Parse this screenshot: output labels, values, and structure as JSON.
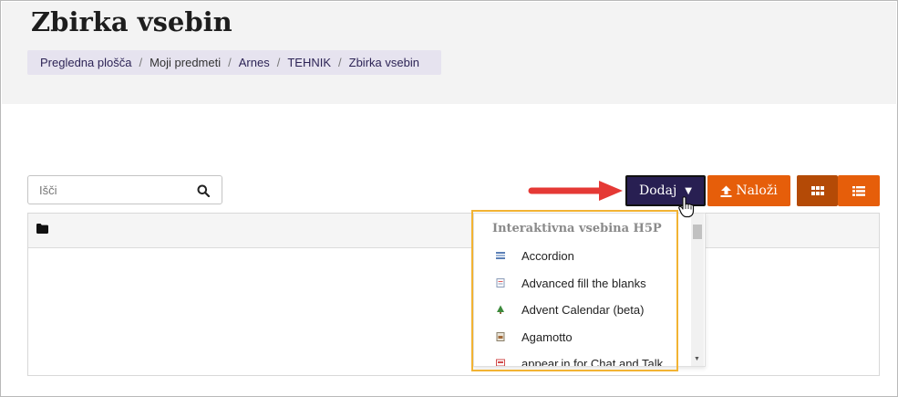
{
  "page": {
    "title": "Zbirka vsebin"
  },
  "breadcrumb": {
    "items": [
      "Pregledna plošča",
      "Moji predmeti",
      "Arnes",
      "TEHNIK",
      "Zbirka vsebin"
    ]
  },
  "search": {
    "placeholder": "Išči",
    "value": ""
  },
  "toolbar": {
    "add_label": "Dodaj",
    "upload_label": "Naloži"
  },
  "dropdown": {
    "header": "Interaktivna vsebina H5P",
    "items": [
      {
        "label": "Accordion",
        "icon": "accordion-icon"
      },
      {
        "label": "Advanced fill the blanks",
        "icon": "fill-blanks-icon"
      },
      {
        "label": "Advent Calendar (beta)",
        "icon": "tree-icon"
      },
      {
        "label": "Agamotto",
        "icon": "agamotto-icon"
      },
      {
        "label": "appear.in for Chat and Talk",
        "icon": "chat-icon"
      }
    ]
  },
  "colors": {
    "add_button": "#281f52",
    "upload_button": "#e65e0a",
    "highlight": "#f2b333",
    "arrow": "#e53935"
  }
}
